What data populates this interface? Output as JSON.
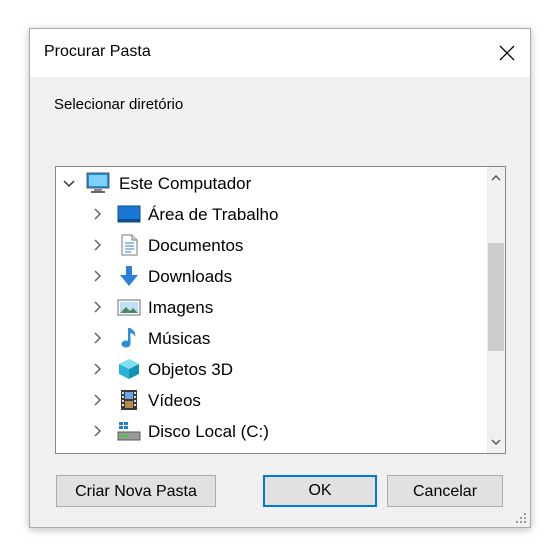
{
  "dialog": {
    "title": "Procurar Pasta",
    "subtitle": "Selecionar diretório",
    "close_icon": "close-icon"
  },
  "tree": {
    "root": {
      "label": "Este Computador",
      "icon": "computer-icon",
      "expanded": true
    },
    "items": [
      {
        "label": "Área de Trabalho",
        "icon": "desktop-icon"
      },
      {
        "label": "Documentos",
        "icon": "documents-icon"
      },
      {
        "label": "Downloads",
        "icon": "downloads-icon"
      },
      {
        "label": "Imagens",
        "icon": "pictures-icon"
      },
      {
        "label": "Músicas",
        "icon": "music-icon"
      },
      {
        "label": "Objetos 3D",
        "icon": "objects-3d-icon"
      },
      {
        "label": "Vídeos",
        "icon": "videos-icon"
      },
      {
        "label": "Disco Local (C:)",
        "icon": "local-disk-icon"
      }
    ]
  },
  "buttons": {
    "new_folder": "Criar Nova Pasta",
    "ok": "OK",
    "cancel": "Cancelar"
  },
  "colors": {
    "accent": "#0078d7",
    "dialog_bg": "#f0f0f0",
    "button_bg": "#e1e1e1"
  }
}
